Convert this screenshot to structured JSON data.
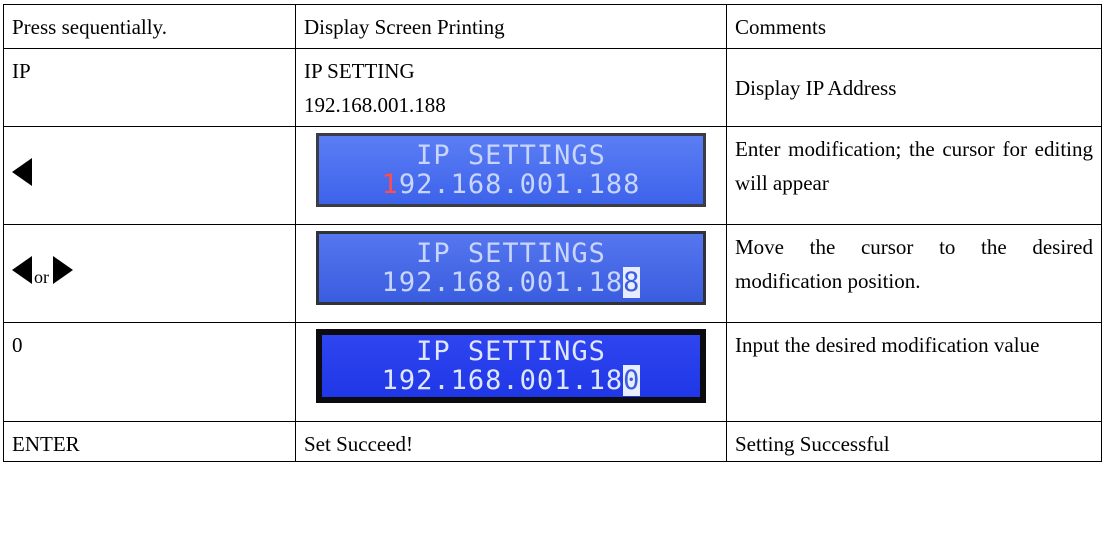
{
  "headers": [
    "Press sequentially.",
    "Display Screen Printing",
    "Comments"
  ],
  "rows": [
    {
      "press": "IP",
      "display_lines": [
        "IP SETTING",
        "192.168.001.188"
      ],
      "comment": "Display IP Address"
    },
    {
      "press_icon": "left-arrow-icon",
      "lcd": {
        "line1": "IP SETTINGS",
        "line2_cursor": "1",
        "line2_rest": "92.168.001.188"
      },
      "comment": "Enter modification; the cursor for editing will appear"
    },
    {
      "press_icon": "left-or-right-arrow-icons",
      "press_or": "or",
      "lcd": {
        "line1": "IP SETTINGS",
        "line2_prefix": "192.168.001.18",
        "line2_cursor": "8"
      },
      "comment": "Move the cursor to the desired modification position."
    },
    {
      "press": "0",
      "lcd": {
        "line1": "IP SETTINGS",
        "line2_prefix": "192.168.001.18",
        "line2_cursor": "0"
      },
      "comment": "Input the desired modification value"
    },
    {
      "press": "ENTER",
      "display": "Set Succeed!",
      "comment": "Setting Successful"
    }
  ],
  "colors": {
    "lcd_blue": "#4c6ff0",
    "lcd_text": "#c8d6ff",
    "cursor_red": "#ff4d4d"
  }
}
